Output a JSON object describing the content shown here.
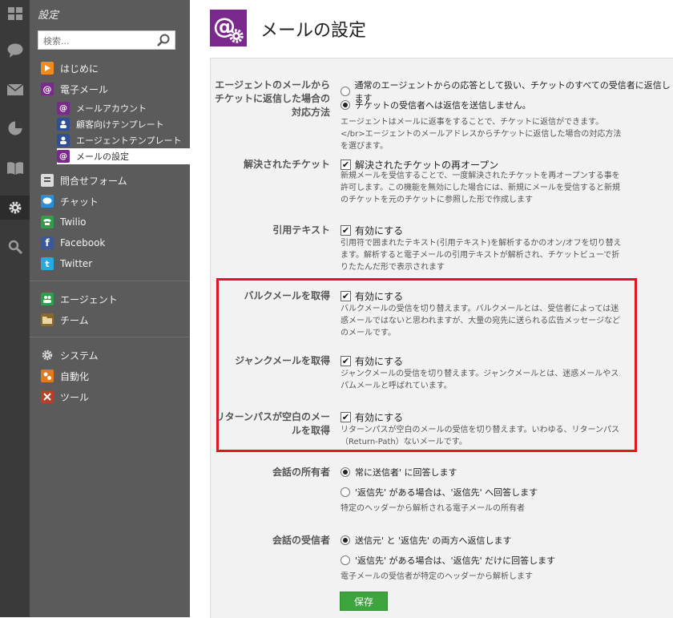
{
  "sidebar": {
    "title": "設定",
    "search_placeholder": "検索...",
    "items": [
      {
        "label": "はじめに"
      },
      {
        "label": "電子メール"
      },
      {
        "label": "メールアカウント"
      },
      {
        "label": "顧客向けテンプレート"
      },
      {
        "label": "エージェントテンプレート"
      },
      {
        "label": "メールの設定"
      },
      {
        "label": "問合せフォーム"
      },
      {
        "label": "チャット"
      },
      {
        "label": "Twilio"
      },
      {
        "label": "Facebook"
      },
      {
        "label": "Twitter"
      },
      {
        "label": "エージェント"
      },
      {
        "label": "チーム"
      },
      {
        "label": "システム"
      },
      {
        "label": "自動化"
      },
      {
        "label": "ツール"
      }
    ]
  },
  "main": {
    "title": "メールの設定",
    "sections": {
      "agent_reply": {
        "label": "エージェントのメールからチケットに返信した場合の対応方法",
        "opt1": "通常のエージェントからの応答として扱い、チケットのすべての受信者に返信します",
        "opt2": "チケットの受信者へは返信を送信しません。",
        "opt_selected": 2,
        "desc": "エージェントはメールに返事をすることで、チケットに返信ができます。</br>エージェントのメールアドレスからチケットに返信した場合の対応方法を選びます。"
      },
      "resolved": {
        "label": "解決されたチケット",
        "check": "解決されたチケットの再オープン",
        "checked": true,
        "desc": "新規メールを受信することで、一度解決されたチケットを再オープンする事を許可します。この機能を無効にした場合には、新規にメールを受信すると新規のチケットを元のチケットに参照した形で作成します"
      },
      "quote": {
        "label": "引用テキスト",
        "check": "有効にする",
        "checked": true,
        "desc": "引用符で囲まれたテキスト(引用テキスト)を解析するかのオン/オフを切り替えます。解析すると電子メールの引用テキストが解析され、チケットビューで折りたたんだ形で表示されます"
      },
      "bulk": {
        "label": "バルクメールを取得",
        "check": "有効にする",
        "checked": true,
        "desc": "バルクメールの受信を切り替えます。バルクメールとは、受信者によっては迷惑メールではないと思われますが、大量の宛先に送られる広告メッセージなどのメールです。"
      },
      "junk": {
        "label": "ジャンクメールを取得",
        "check": "有効にする",
        "checked": true,
        "desc": "ジャンクメールの受信を切り替えます。ジャンクメールとは、迷惑メールやスパムメールと呼ばれています。"
      },
      "return_path": {
        "label": "リターンパスが空白のメールを取得",
        "check": "有効にする",
        "checked": true,
        "desc": "リターンパスが空白のメールの受信を切り替えます。いわゆる、リターンパス（Return-Path）ないメールです。"
      },
      "owner": {
        "label": "会話の所有者",
        "opt1": "常に送信者' に回答します",
        "opt2": "'返信先' がある場合は、'返信先' へ回答します",
        "opt_selected": 1,
        "desc": "特定のヘッダーから解析される電子メールの所有者"
      },
      "recipients": {
        "label": "会話の受信者",
        "opt1": "送信元' と '返信先' の両方へ返信します",
        "opt2": "'返信先' がある場合は、'返信先' だけに回答します",
        "opt_selected": 1,
        "desc": "電子メールの受信者が特定のヘッダーから解析します"
      }
    },
    "save_label": "保存"
  },
  "colors": {
    "highlight_box": "#e3141c",
    "save_button": "#3ea43e",
    "page_icon": "#7a2a8c"
  }
}
